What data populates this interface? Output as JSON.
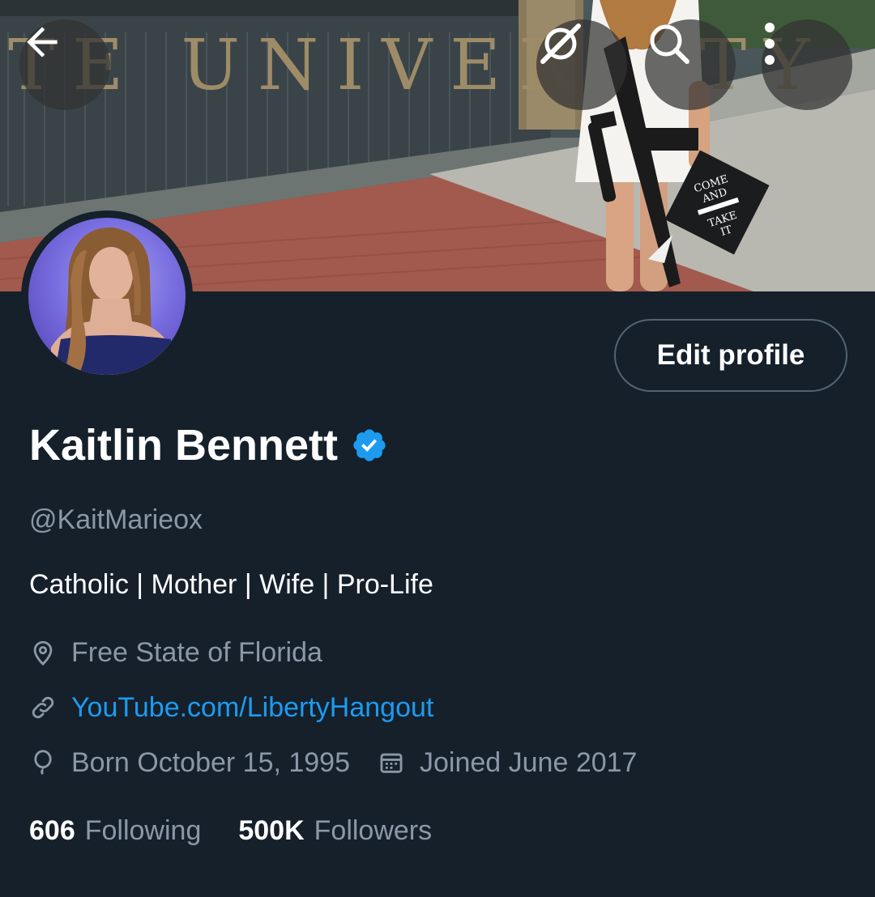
{
  "header": {
    "back_icon": "arrow-left-icon",
    "grok_icon": "grok-icon",
    "search_icon": "search-icon",
    "more_icon": "more-vertical-icon",
    "banner_text": "TE UNIVERSITY",
    "cap_text_lines": [
      "COME",
      "AND",
      "TAKE",
      "IT"
    ]
  },
  "profile": {
    "display_name": "Kaitlin Bennett",
    "verified_icon": "verified-badge-icon",
    "handle": "@KaitMarieox",
    "bio": "Catholic | Mother | Wife | Pro-Life",
    "location": "Free State of Florida",
    "website": "YouTube.com/LibertyHangout",
    "birthday": "Born October 15, 1995",
    "joined": "Joined June 2017",
    "edit_button_label": "Edit profile"
  },
  "stats": {
    "following_count": "606",
    "following_label": "Following",
    "followers_count": "500K",
    "followers_label": "Followers"
  },
  "colors": {
    "background": "#15202b",
    "text_primary": "#ffffff",
    "text_secondary": "#8b98a5",
    "link": "#1d9bf0",
    "verified": "#1d9bf0",
    "border": "#536471"
  }
}
